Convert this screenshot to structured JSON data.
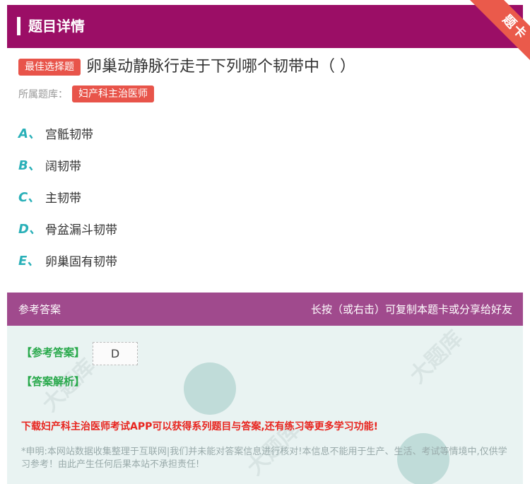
{
  "header": {
    "title": "题目详情",
    "ribbon": "题卡"
  },
  "question": {
    "type_tag": "最佳选择题",
    "text": "卵巢动静脉行走于下列哪个韧带中（ ）",
    "library_label": "所属题库：",
    "library_tag": "妇产科主治医师"
  },
  "options": [
    {
      "letter": "A、",
      "text": "宫骶韧带"
    },
    {
      "letter": "B、",
      "text": "阔韧带"
    },
    {
      "letter": "C、",
      "text": "主韧带"
    },
    {
      "letter": "D、",
      "text": "骨盆漏斗韧带"
    },
    {
      "letter": "E、",
      "text": "卵巢固有韧带"
    }
  ],
  "answer": {
    "header_left": "参考答案",
    "header_right": "长按（或右击）可复制本题卡或分享给好友",
    "answer_label": "【参考答案】",
    "answer_value": "D",
    "analysis_label": "【答案解析】",
    "download_text": "下载妇产科主治医师考试APP可以获得系列题目与答案,还有练习等更多学习功能!",
    "notice_text": "*申明:本网站数据收集整理于互联网|我们并未能对答案信息进行核对!本信息不能用于生产、生活、考试等情境中,仅供学习参考！由此产生任何后果本站不承担责任!"
  },
  "colors": {
    "header_bg": "#9b0e66",
    "tag_red": "#e8544a",
    "option_letter": "#2ab0b8",
    "answer_header": "#a04a8d",
    "answer_body": "#e9f3f2",
    "answer_green": "#27a84a",
    "download_red": "#e8251f"
  }
}
